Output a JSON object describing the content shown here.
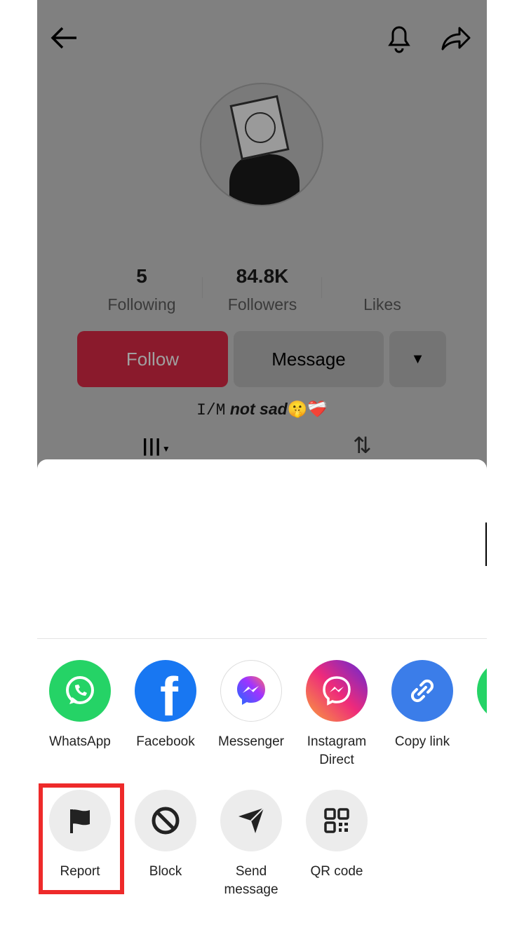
{
  "header": {
    "back_icon": "arrow-left-icon",
    "bell_icon": "bell-icon",
    "share_icon": "share-arrow-icon"
  },
  "profile": {
    "avatar": "profile-avatar",
    "stats": [
      {
        "value": "5",
        "label": "Following"
      },
      {
        "value": "84.8K",
        "label": "Followers"
      },
      {
        "value": "",
        "label": "Likes"
      }
    ],
    "follow_label": "Follow",
    "message_label": "Message",
    "bio_prefix": "I/M",
    "bio_bold": "not sad",
    "bio_emoji": "🤫❤️‍🩹",
    "accent": "#8a1a2c"
  },
  "share_row": [
    {
      "label": "WhatsApp",
      "color": "#25d366",
      "icon": "whatsapp-icon"
    },
    {
      "label": "Facebook",
      "color": "#1877f2",
      "icon": "facebook-icon"
    },
    {
      "label": "Messenger",
      "color": "#ffffff",
      "icon": "messenger-icon"
    },
    {
      "label": "Instagram Direct",
      "color": "#e1306c",
      "icon": "instagram-direct-icon"
    },
    {
      "label": "Copy link",
      "color": "#3b7de9",
      "icon": "link-icon"
    }
  ],
  "action_row": [
    {
      "label": "Report",
      "icon": "flag-icon"
    },
    {
      "label": "Block",
      "icon": "block-icon"
    },
    {
      "label": "Send message",
      "icon": "send-icon"
    },
    {
      "label": "QR code",
      "icon": "qr-code-icon"
    }
  ],
  "highlight_color": "#ee2a2a"
}
